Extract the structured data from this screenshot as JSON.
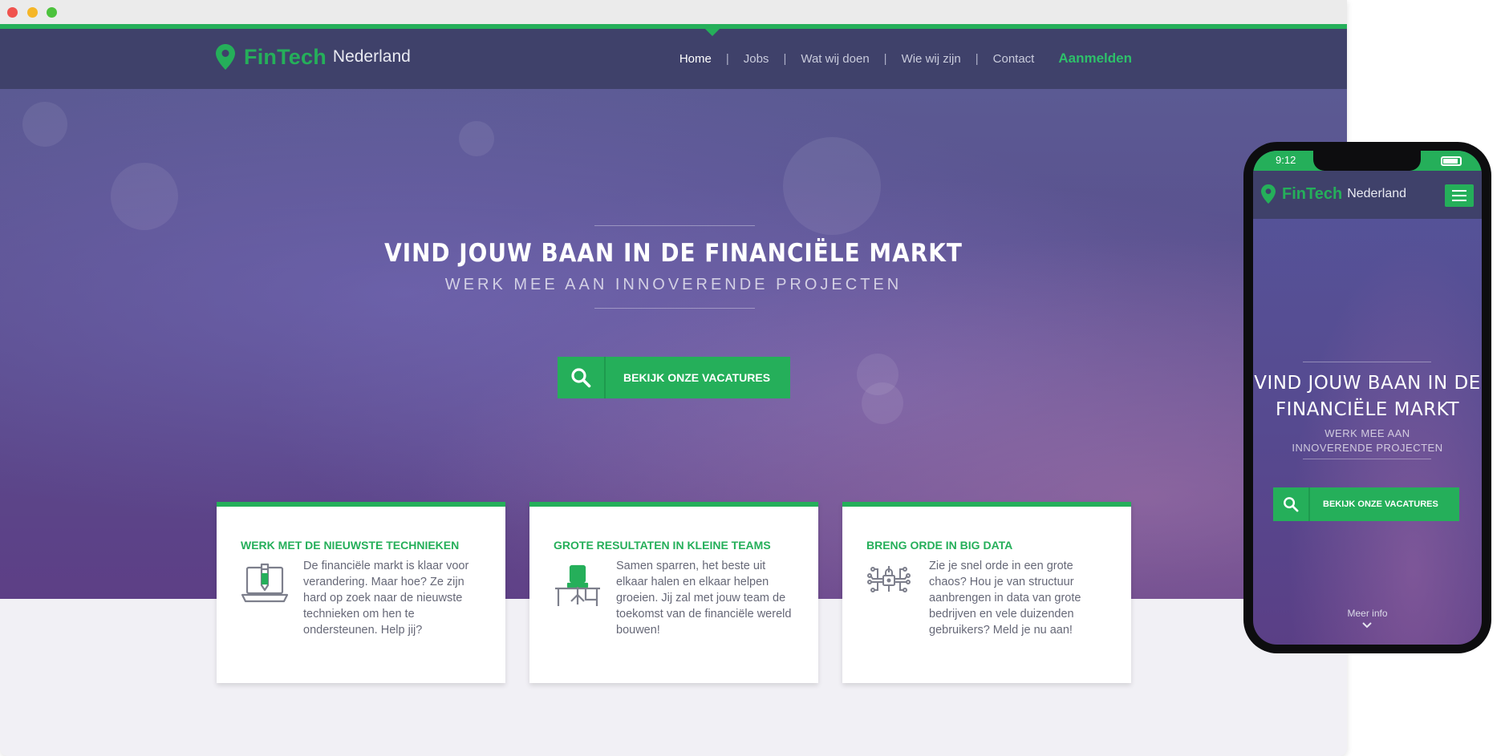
{
  "desktop": {
    "brand": {
      "main": "FinTech",
      "sub": "Nederland"
    },
    "nav": {
      "items": [
        "Home",
        "Jobs",
        "Wat wij doen",
        "Wie wij zijn",
        "Contact"
      ],
      "separator": "|",
      "cta": "Aanmelden",
      "active": "Home"
    },
    "hero": {
      "title": "VIND JOUW BAAN IN DE FINANCIËLE MARKT",
      "subtitle": "WERK MEE AAN INNOVERENDE PROJECTEN",
      "cta_label": "BEKIJK ONZE VACATURES"
    },
    "cards": [
      {
        "title": "WERK MET DE NIEUWSTE TECHNIEKEN",
        "icon": "laptop-pen-icon",
        "text": "De financiële markt is klaar voor verandering. Maar hoe? Ze zijn hard op zoek naar de nieuwste technieken om hen te ondersteunen. Help jij?"
      },
      {
        "title": "GROTE RESULTATEN IN KLEINE TEAMS",
        "icon": "desk-chair-icon",
        "text": "Samen sparren, het beste uit elkaar halen en elkaar helpen groeien. Jij zal met jouw team de toekomst van de financiële wereld bouwen!"
      },
      {
        "title": "BRENG ORDE IN BIG DATA",
        "icon": "data-lock-icon",
        "text": "Zie je snel orde in een grote chaos? Hou je van structuur aanbrengen in data van grote bedrijven en vele duizenden gebruikers? Meld je nu aan!"
      }
    ]
  },
  "mobile": {
    "status_time": "9:12",
    "brand": {
      "main": "FinTech",
      "sub": "Nederland"
    },
    "hero": {
      "title_line1": "VIND JOUW BAAN IN DE",
      "title_line2": "FINANCIËLE MARKT",
      "subtitle": "WERK MEE AAN INNOVERENDE PROJECTEN",
      "cta_label": "BEKIJK ONZE VACATURES"
    },
    "more_label": "Meer info"
  },
  "colors": {
    "accent": "#25af5a",
    "navbar": "#3f416a",
    "hero": "#5a4b8c",
    "page_bg": "#f1f0f5"
  }
}
